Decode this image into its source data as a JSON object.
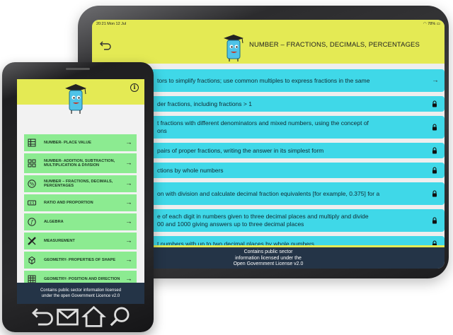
{
  "tablet": {
    "status_time": "20:21  Mon 12 Jul",
    "status_right": "78%",
    "title": "NUMBER – FRACTIONS, DECIMALS, PERCENTAGES",
    "rows": [
      {
        "text": "tors to simplify fractions; use common multiples to express fractions in the same",
        "icon": "arrow-right-icon"
      },
      {
        "text": "der fractions, including fractions > 1",
        "icon": "lock-icon"
      },
      {
        "text": "t fractions with different denominators and mixed numbers, using the concept of",
        "text2": "ons",
        "icon": "lock-icon"
      },
      {
        "text": "pairs of proper fractions, writing the answer in its simplest form",
        "icon": "lock-icon"
      },
      {
        "text": "ctions by whole numbers",
        "icon": "lock-icon"
      },
      {
        "text": "on with division and calculate decimal fraction equivalents [for example, 0.375] for a",
        "icon": "lock-icon"
      },
      {
        "text": "e of each digit in numbers given to three decimal places and multiply and divide",
        "text2": "00 and 1000 giving answers up to three decimal places",
        "icon": "lock-icon"
      },
      {
        "text": "t numbers with up to two decimal places by whole numbers",
        "icon": "lock-icon"
      }
    ],
    "footer": [
      "Contains public sector",
      "information licensed under the",
      "Open Government License v2.0"
    ]
  },
  "phone": {
    "info_label": "i",
    "items": [
      {
        "label": "Number- Place Value",
        "icon": "place-value-icon"
      },
      {
        "label": "Number- Addition, Subtraction, Multiplication & Division",
        "icon": "operations-icon"
      },
      {
        "label": "Number – Fractions, Decimals, Percentages",
        "icon": "percent-icon"
      },
      {
        "label": "Ratio and Proportion",
        "icon": "ratio-icon"
      },
      {
        "label": "Algebra",
        "icon": "algebra-icon"
      },
      {
        "label": "Measurement",
        "icon": "ruler-icon"
      },
      {
        "label": "Geometry- Properties of Shape",
        "icon": "cube-icon"
      },
      {
        "label": "Geometry- Position and Direction",
        "icon": "grid-icon"
      }
    ],
    "arrow_glyph": "→",
    "footer": [
      "Contains public sector information licensed",
      "under the open Government Licence v2.0"
    ]
  },
  "colors": {
    "header_yellow": "#e4ea54",
    "tablet_row": "#3fd8e8",
    "phone_item": "#8ceb91",
    "footer_navy": "#243447"
  }
}
